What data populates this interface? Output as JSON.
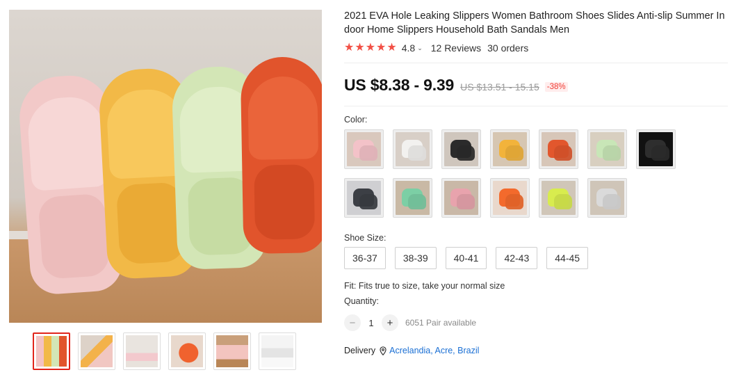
{
  "product": {
    "title": "2021 EVA Hole Leaking Slippers Women Bathroom Shoes Slides Anti-slip Summer In door Home Slippers Household Bath Sandals Men",
    "rating": "4.8",
    "reviews": "12 Reviews",
    "orders": "30 orders",
    "price": "US $8.38 - 9.39",
    "original_price": "US $13.51 - 15.15",
    "discount": "-38%"
  },
  "colors": {
    "accent": "#e1251b",
    "star": "#f25046",
    "link": "#1a6fd4"
  },
  "gallery": {
    "thumbnails": [
      {
        "name": "thumb-four-colors",
        "selected": true
      },
      {
        "name": "thumb-lifestyle",
        "selected": false
      },
      {
        "name": "thumb-sink",
        "selected": false
      },
      {
        "name": "thumb-orange",
        "selected": false
      },
      {
        "name": "thumb-pink-pair",
        "selected": false
      },
      {
        "name": "thumb-sole",
        "selected": false
      }
    ]
  },
  "options": {
    "color_label": "Color:",
    "color_swatches": [
      {
        "name": "pink",
        "bg": "#d9c8bd",
        "shoe": "#f3c2c8"
      },
      {
        "name": "white",
        "bg": "#d8cfc7",
        "shoe": "#f2f1ef"
      },
      {
        "name": "black",
        "bg": "#cfc6bd",
        "shoe": "#2b2b2b"
      },
      {
        "name": "yellow",
        "bg": "#d6c6b2",
        "shoe": "#f2b33b"
      },
      {
        "name": "orange-red",
        "bg": "#d7c6b8",
        "shoe": "#e2572d"
      },
      {
        "name": "light-green",
        "bg": "#d8cfc0",
        "shoe": "#c8e6b7"
      },
      {
        "name": "black-solid",
        "bg": "#111111",
        "shoe": "#2e2e2e"
      },
      {
        "name": "dark-gray",
        "bg": "#cfcfd2",
        "shoe": "#3c3f45"
      },
      {
        "name": "mint",
        "bg": "#c9b9a5",
        "shoe": "#7ccfa5"
      },
      {
        "name": "rose",
        "bg": "#c9b8a7",
        "shoe": "#e8a3ad"
      },
      {
        "name": "coral",
        "bg": "#e9d8cc",
        "shoe": "#f36a2c"
      },
      {
        "name": "lime",
        "bg": "#d0c6b8",
        "shoe": "#d8ec4e"
      },
      {
        "name": "light-gray",
        "bg": "#cfc5b8",
        "shoe": "#dadada"
      }
    ],
    "size_label": "Shoe Size:",
    "sizes": [
      "36-37",
      "38-39",
      "40-41",
      "42-43",
      "44-45"
    ],
    "fit_text": "Fit: Fits true to size, take your normal size",
    "quantity_label": "Quantity:",
    "quantity": "1",
    "minus": "−",
    "plus": "+",
    "available": "6051 Pair available"
  },
  "delivery": {
    "label": "Delivery",
    "location": "Acrelandia, Acre, Brazil"
  }
}
